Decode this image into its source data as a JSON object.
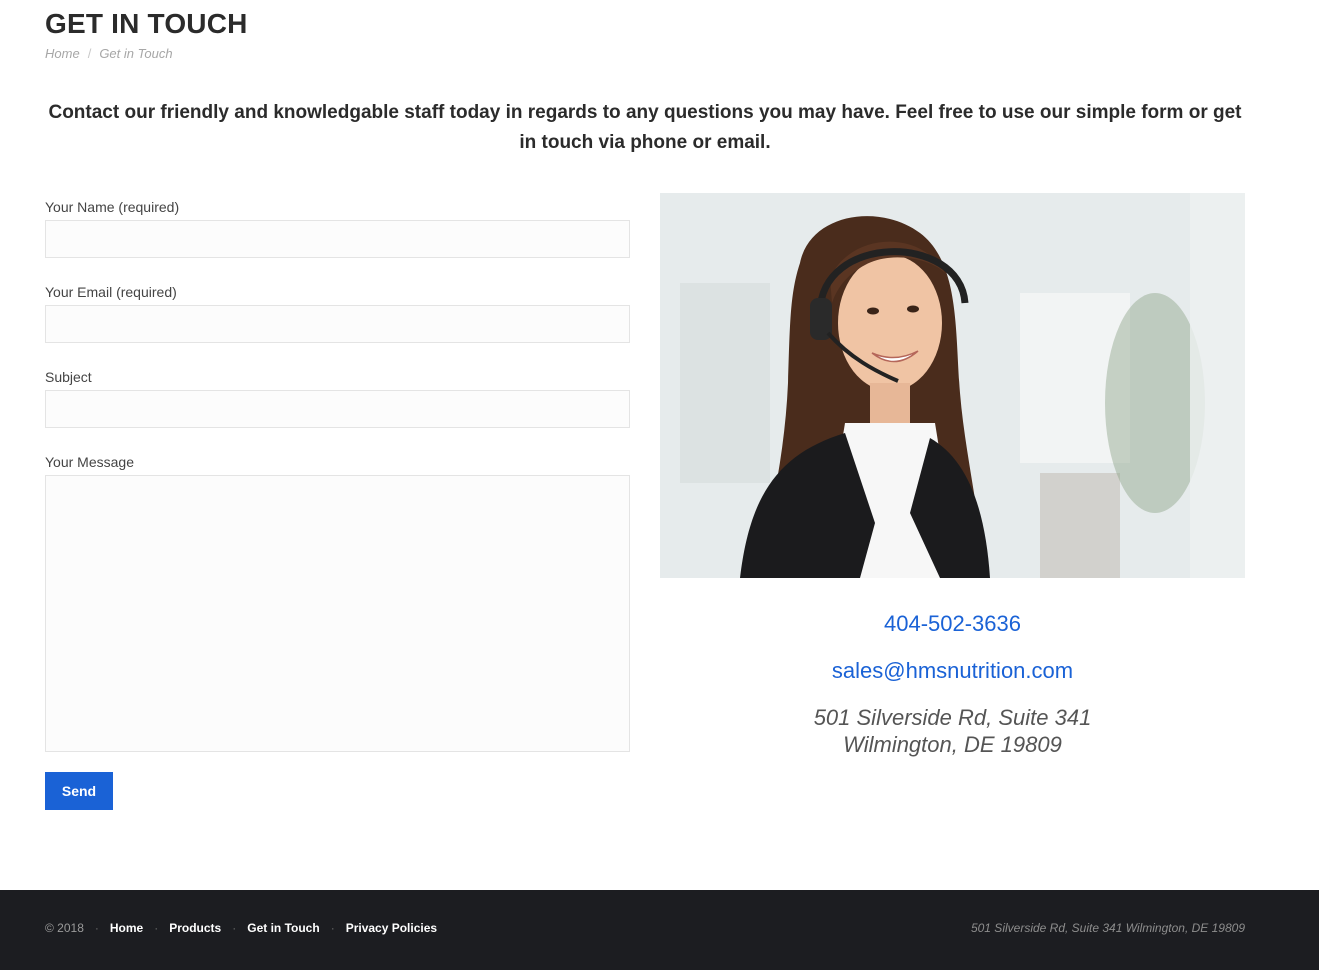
{
  "header": {
    "title": "GET IN TOUCH",
    "breadcrumb": {
      "home": "Home",
      "separator": "/",
      "current": "Get in Touch"
    }
  },
  "intro": {
    "text": "Contact our friendly and knowledgable staff today in regards to any questions you may have.  Feel free to use our simple form or get in touch via phone or email."
  },
  "form": {
    "name_label": "Your Name (required)",
    "name_value": "",
    "email_label": "Your Email (required)",
    "email_value": "",
    "subject_label": "Subject",
    "subject_value": "",
    "message_label": "Your Message",
    "message_value": "",
    "send_label": "Send"
  },
  "contact": {
    "phone": "404-502-3636",
    "email": "sales@hmsnutrition.com",
    "address_line1": "501 Silverside Rd, Suite 341",
    "address_line2": "Wilmington, DE 19809"
  },
  "footer": {
    "copyright": "© 2018",
    "separator": "·",
    "links": [
      "Home",
      "Products",
      "Get in Touch",
      "Privacy Policies"
    ],
    "address": "501 Silverside Rd, Suite 341 Wilmington, DE 19809"
  },
  "colors": {
    "accent": "#1a62d6",
    "footer_bg": "#1c1d21",
    "heading": "#2b2b2b"
  }
}
